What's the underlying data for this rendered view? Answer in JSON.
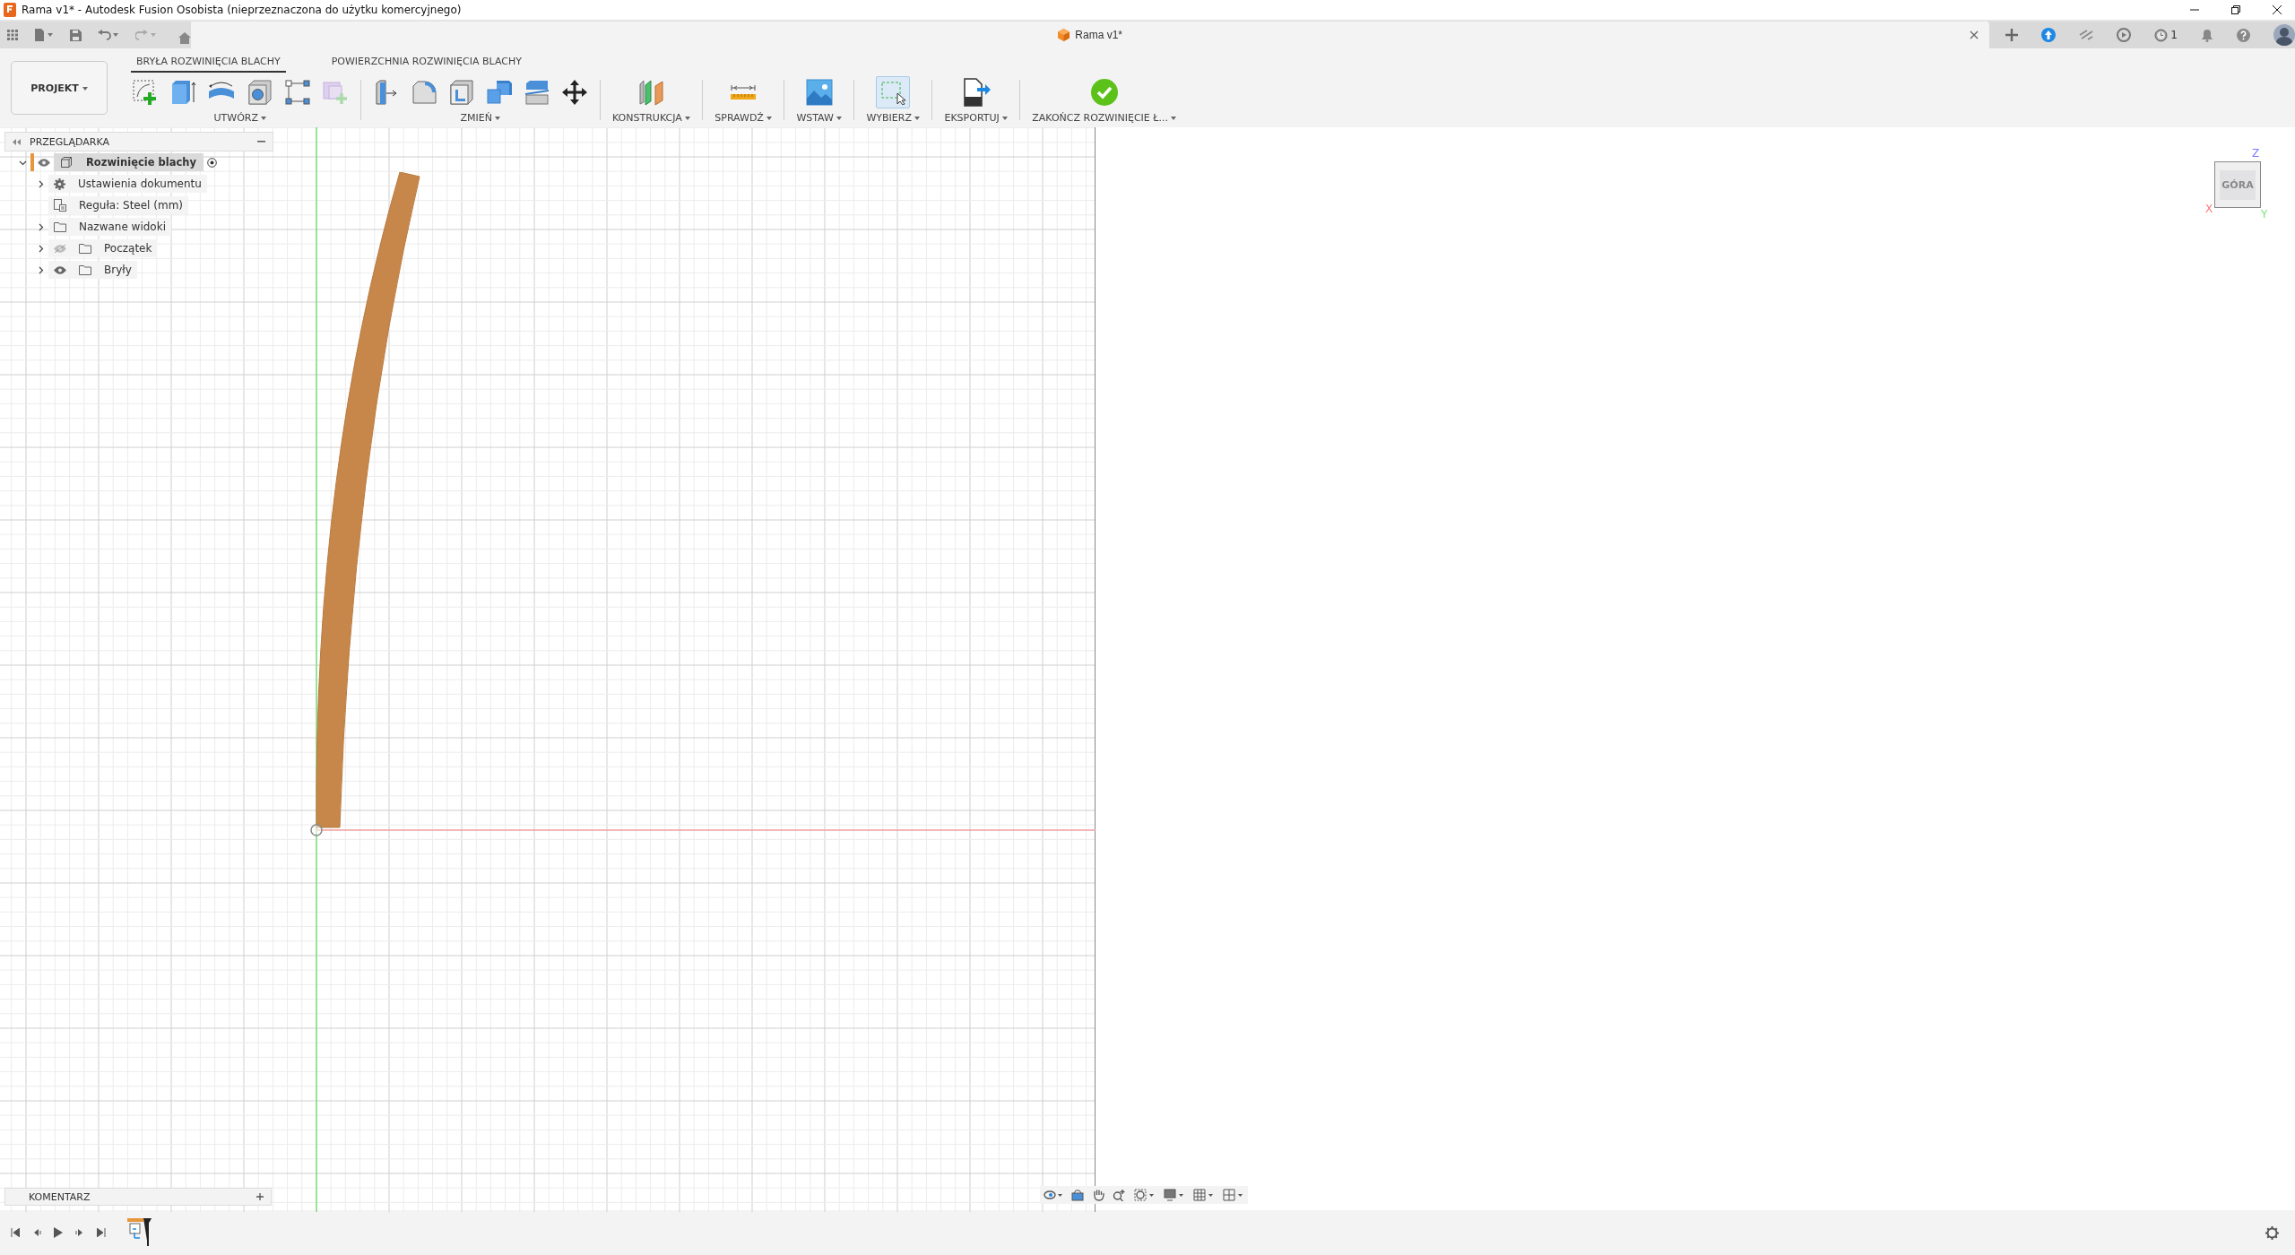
{
  "window": {
    "title": "Rama v1* - Autodesk Fusion Osobista (nieprzeznaczona do użytku komercyjnego)"
  },
  "document_tab": {
    "title": "Rama v1*"
  },
  "job_status": {
    "count": "1"
  },
  "project_button": "PROJEKT",
  "tabs": [
    {
      "label": "BRYŁA ROZWINIĘCIA BLACHY",
      "selected": true
    },
    {
      "label": "POWIERZCHNIA ROZWINIĘCIA BLACHY",
      "selected": false
    }
  ],
  "tool_groups": [
    {
      "kind": "create",
      "label": "UTWÓRZ"
    },
    {
      "kind": "modify",
      "label": "ZMIEŃ"
    },
    {
      "kind": "construct",
      "label": "KONSTRUKCJA"
    },
    {
      "kind": "inspect",
      "label": "SPRAWDŹ"
    },
    {
      "kind": "insert",
      "label": "WSTAW"
    },
    {
      "kind": "select",
      "label": "WYBIERZ"
    },
    {
      "kind": "export",
      "label": "EKSPORTUJ"
    },
    {
      "kind": "finish",
      "label": "ZAKOŃCZ ROZWINIĘCIE Ł..."
    }
  ],
  "browser": {
    "title": "PRZEGLĄDARKA",
    "root": {
      "label": "Rozwinięcie blachy",
      "expanded": true,
      "visible": true,
      "children": [
        {
          "kind": "settings",
          "label": "Ustawienia dokumentu"
        },
        {
          "kind": "rule",
          "label": "Reguła: Steel (mm)"
        },
        {
          "kind": "views",
          "label": "Nazwane widoki"
        },
        {
          "kind": "folder",
          "label": "Początek",
          "visible": false
        },
        {
          "kind": "folder",
          "label": "Bryły",
          "visible": true
        }
      ]
    }
  },
  "view_cube": {
    "face": "GÓRA",
    "x_label": "X",
    "y_label": "Y",
    "z_label": "Z"
  },
  "comments": {
    "title": "KOMENTARZ"
  }
}
